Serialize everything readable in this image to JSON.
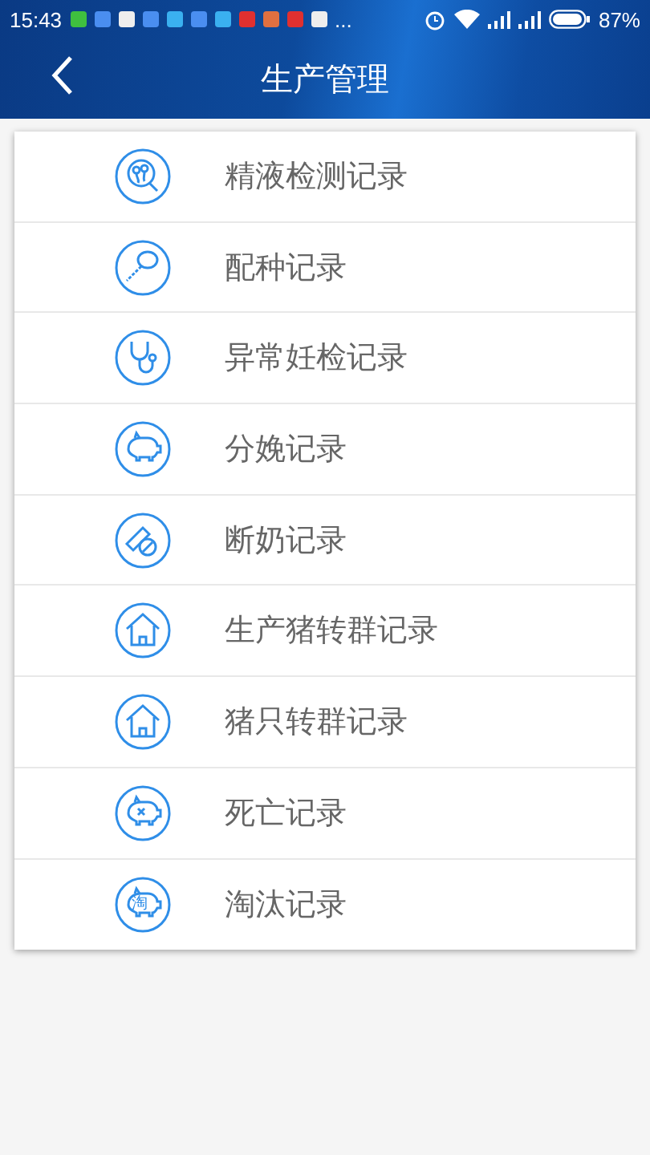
{
  "status_bar": {
    "time": "15:43",
    "more": "...",
    "battery_text": "87%"
  },
  "header": {
    "title": "生产管理"
  },
  "menu": [
    {
      "label": "精液检测记录",
      "kind": "sperm"
    },
    {
      "label": "配种记录",
      "kind": "probe"
    },
    {
      "label": "异常妊检记录",
      "kind": "stethoscope"
    },
    {
      "label": "分娩记录",
      "kind": "pig"
    },
    {
      "label": "断奶记录",
      "kind": "bottle"
    },
    {
      "label": "生产猪转群记录",
      "kind": "house"
    },
    {
      "label": "猪只转群记录",
      "kind": "house"
    },
    {
      "label": "死亡记录",
      "kind": "pig-dead"
    },
    {
      "label": "淘汰记录",
      "kind": "pig-cull",
      "icon_text": "淘"
    }
  ]
}
